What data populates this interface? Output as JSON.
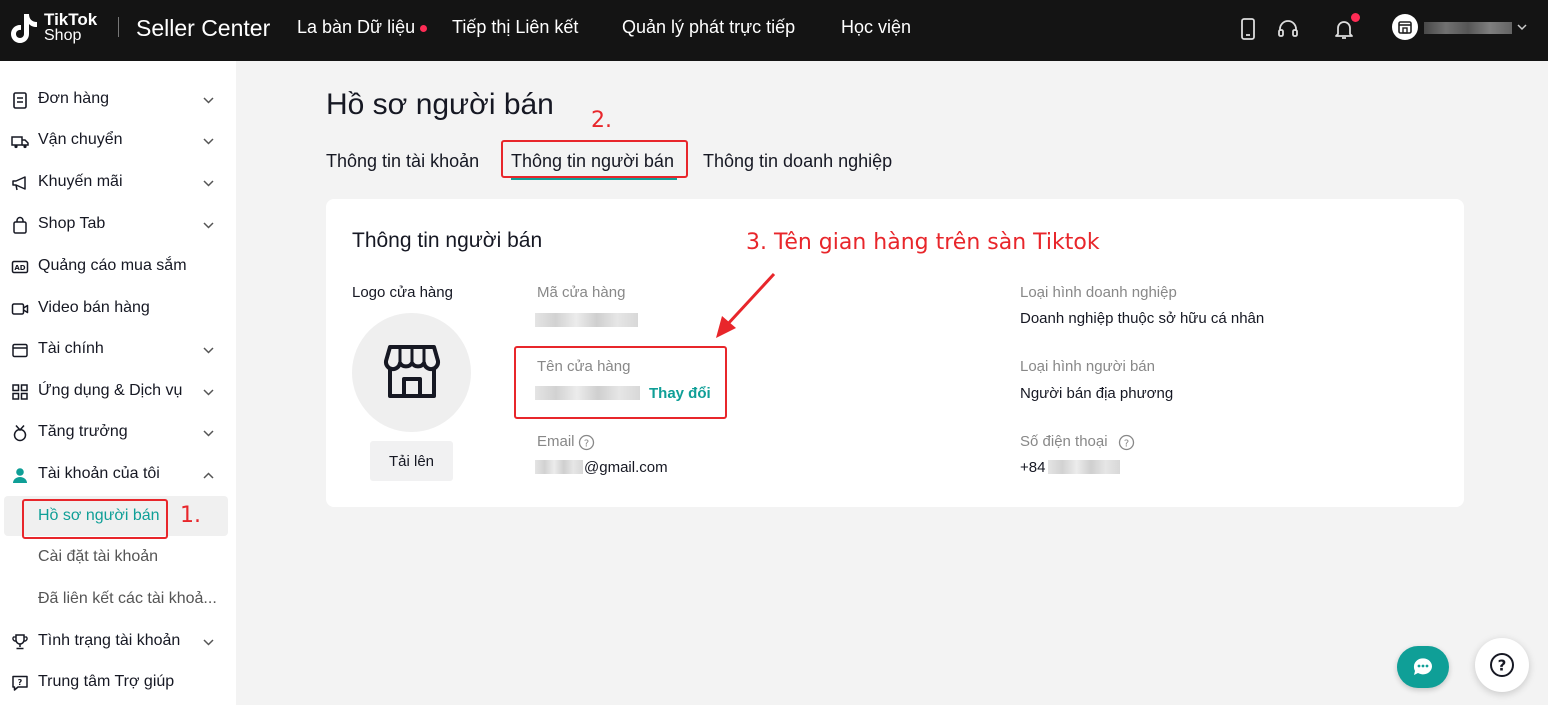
{
  "topbar": {
    "logo_line1": "TikTok",
    "logo_line2": "Shop",
    "app_name": "Seller Center",
    "nav": [
      "La bàn Dữ liệu",
      "Tiếp thị Liên kết",
      "Quản lý phát trực tiếp",
      "Học viện"
    ]
  },
  "sidebar": {
    "items": [
      {
        "label": "Đơn hàng",
        "icon": "clipboard-icon"
      },
      {
        "label": "Vận chuyển",
        "icon": "truck-icon"
      },
      {
        "label": "Khuyến mãi",
        "icon": "megaphone-icon"
      },
      {
        "label": "Shop Tab",
        "icon": "shopping-bag-icon"
      },
      {
        "label": "Quảng cáo mua sắm",
        "icon": "ad-icon"
      },
      {
        "label": "Video bán hàng",
        "icon": "video-icon"
      },
      {
        "label": "Tài chính",
        "icon": "wallet-icon"
      },
      {
        "label": "Ứng dụng & Dịch vụ",
        "icon": "apps-icon"
      },
      {
        "label": "Tăng trưởng",
        "icon": "medal-icon"
      },
      {
        "label": "Tài khoản của tôi",
        "icon": "user-icon"
      }
    ],
    "subitems": [
      "Hồ sơ người bán",
      "Cài đặt tài khoản",
      "Đã liên kết các tài khoả..."
    ],
    "bottom_items": [
      {
        "label": "Tình trạng tài khoản",
        "icon": "trophy-icon"
      },
      {
        "label": "Trung tâm Trợ giúp",
        "icon": "help-chat-icon"
      }
    ]
  },
  "page": {
    "title": "Hồ sơ người bán",
    "tabs": [
      "Thông tin tài khoản",
      "Thông tin người bán",
      "Thông tin doanh nghiệp"
    ],
    "active_tab": "Thông tin người bán"
  },
  "card": {
    "title": "Thông tin người bán",
    "logo_label": "Logo cửa hàng",
    "upload_label": "Tải lên",
    "shop_code_label": "Mã cửa hàng",
    "shop_name_label": "Tên cửa hàng",
    "change_label": "Thay đổi",
    "email_label": "Email",
    "email_suffix": "@gmail.com",
    "business_type_label": "Loại hình doanh nghiệp",
    "business_type_value": "Doanh nghiệp thuộc sở hữu cá nhân",
    "seller_type_label": "Loại hình người bán",
    "seller_type_value": "Người bán địa phương",
    "phone_label": "Số điện thoại",
    "phone_prefix": "+84"
  },
  "annotations": {
    "step1": "1.",
    "step2": "2.",
    "step3": "3. Tên gian hàng trên sàn Tiktok"
  },
  "colors": {
    "accent": "#0f9f97",
    "annotation": "#e8262b",
    "topbar": "#141414"
  }
}
